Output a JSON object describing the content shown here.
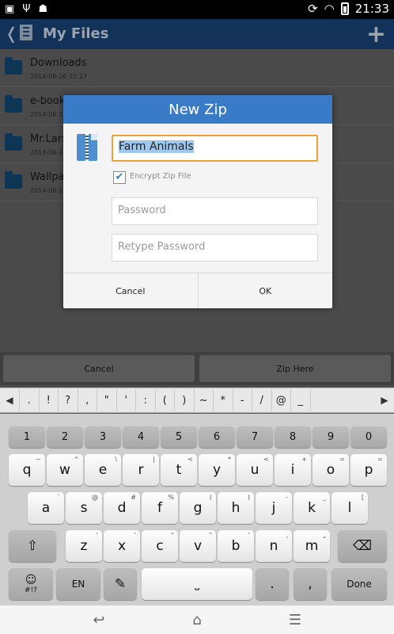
{
  "status_bar": {
    "time": "21:33",
    "icons_left": [
      "image-icon",
      "usb-icon",
      "android-icon"
    ],
    "icons_right": [
      "rotate-icon",
      "wifi-icon",
      "battery-icon"
    ]
  },
  "action_bar": {
    "title": "My Files"
  },
  "files": [
    {
      "name": "Downloads",
      "date": "2014-06-26 21:27"
    },
    {
      "name": "e-book",
      "date": "2014-06-2"
    },
    {
      "name": "Mr.Lars",
      "date": "2014-06-2"
    },
    {
      "name": "Wallpa",
      "date": "2014-06-2"
    }
  ],
  "bottom_buttons": {
    "cancel": "Cancel",
    "zip_here": "Zip Here"
  },
  "dialog": {
    "title": "New Zip",
    "name_value": "Farm Animals",
    "encrypt_label": "Encrypt Zip File",
    "encrypt_checked": true,
    "password_placeholder": "Password",
    "retype_placeholder": "Retype Password",
    "cancel": "Cancel",
    "ok": "OK"
  },
  "symbols": [
    ".",
    "!",
    "?",
    ",",
    "\"",
    "'",
    ":",
    "(",
    ")",
    "~",
    "*",
    "-",
    "/",
    "@",
    "_"
  ],
  "keyboard": {
    "numbers": [
      "1",
      "2",
      "3",
      "4",
      "5",
      "6",
      "7",
      "8",
      "9",
      "0"
    ],
    "row1": [
      [
        "q",
        "~"
      ],
      [
        "w",
        "^"
      ],
      [
        "e",
        "\\"
      ],
      [
        "r",
        "|"
      ],
      [
        "t",
        "<"
      ],
      [
        "y",
        "*"
      ],
      [
        "u",
        "<"
      ],
      [
        "i",
        "+"
      ],
      [
        "o",
        "="
      ],
      [
        "p",
        "="
      ]
    ],
    "row2": [
      [
        "a",
        "`"
      ],
      [
        "s",
        "@"
      ],
      [
        "d",
        "#"
      ],
      [
        "f",
        "%"
      ],
      [
        "g",
        "("
      ],
      [
        "h",
        ")"
      ],
      [
        "j",
        "-"
      ],
      [
        "k",
        "_"
      ],
      [
        "l",
        "["
      ]
    ],
    "row3": [
      [
        "z",
        "‘"
      ],
      [
        "x",
        "’"
      ],
      [
        "c",
        "“"
      ],
      [
        "v",
        "”"
      ],
      [
        "b",
        "‛"
      ],
      [
        "n",
        "‚"
      ],
      [
        "m",
        "„"
      ]
    ],
    "en_label": "EN",
    "emoji_label": "#!?",
    "done_label": "Done",
    "dot_label": ".",
    "comma_label": ","
  }
}
